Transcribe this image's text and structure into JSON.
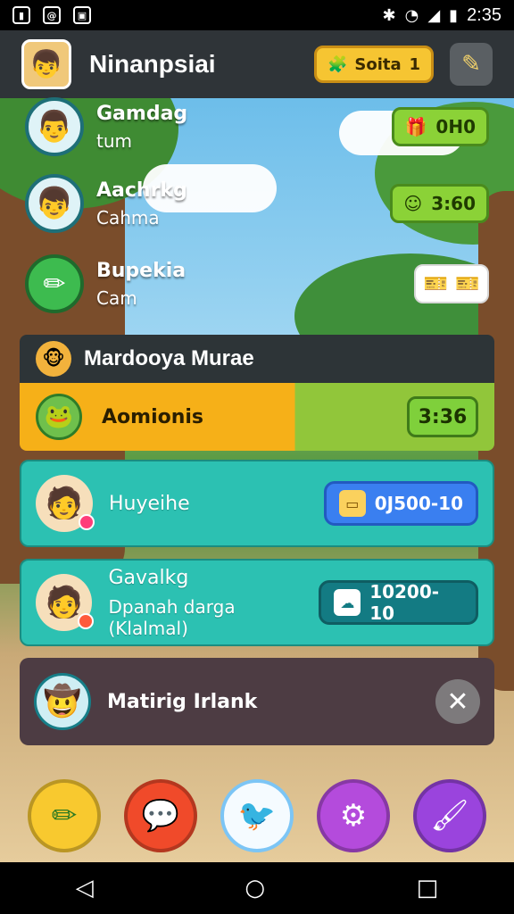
{
  "status_bar": {
    "time": "2:35",
    "left_icons": [
      "lock-icon",
      "at-icon",
      "image-icon"
    ],
    "right_icons": [
      "bluetooth-icon",
      "wifi-icon",
      "signal-icon",
      "battery-icon"
    ]
  },
  "header": {
    "title": "Ninanpsiai",
    "coin_label": "Soita",
    "coin_value": "1"
  },
  "top_list": [
    {
      "name": "Gamdag",
      "sub": "tum",
      "badge": "0H0",
      "badge_style": "green"
    },
    {
      "name": "Aachrkg",
      "sub": "Cahma",
      "badge": "3:60",
      "badge_style": "green"
    },
    {
      "name": "Bupekia",
      "sub": "Cam",
      "badge": "",
      "badge_style": "white"
    }
  ],
  "panel": {
    "title": "Mardooya Murae"
  },
  "highlight_row": {
    "label": "Aomionis",
    "value": "3:36"
  },
  "rows": [
    {
      "name": "Huyeihe",
      "sub": "",
      "button": "0J500-10"
    },
    {
      "name": "Gavalkg",
      "sub": "Dpanah darga (Klalmal)",
      "button": "10200-10"
    }
  ],
  "dark_row": {
    "label": "Matirig Irlank"
  },
  "bottom_buttons": [
    "pencil-icon",
    "chat-bubble-icon",
    "bird-icon",
    "gear-icon",
    "brush-icon"
  ],
  "nav": [
    "back-icon",
    "home-icon",
    "recents-icon"
  ],
  "colors": {
    "header": "#2f3438",
    "teal": "#2cc1b2",
    "orange": "#f6b018",
    "green": "#8bd237",
    "dark_row": "#4d3c43"
  }
}
